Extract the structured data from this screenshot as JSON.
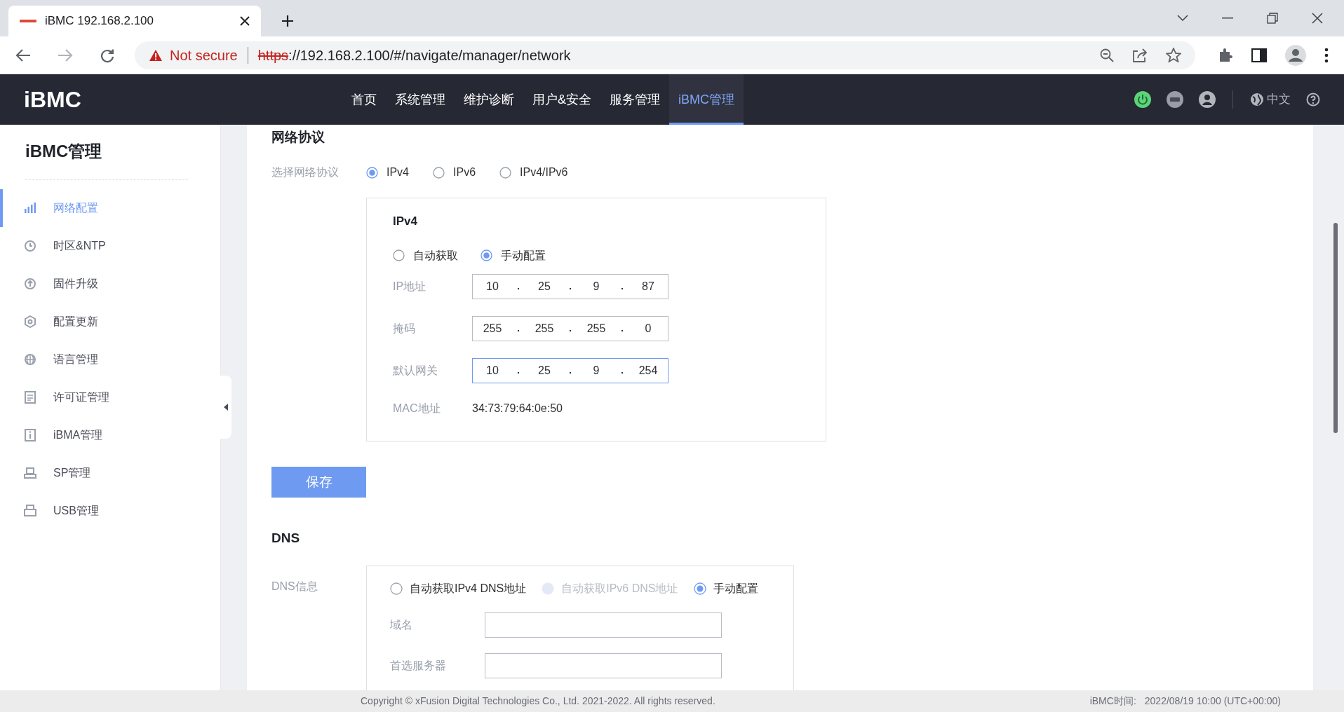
{
  "browser": {
    "tab_title": "iBMC 192.168.2.100",
    "security": "Not secure",
    "url_scheme": "https",
    "url_rest": "://192.168.2.100/#/navigate/manager/network"
  },
  "header": {
    "logo": "iBMC",
    "nav": [
      {
        "label": "首页",
        "selected": false
      },
      {
        "label": "系统管理",
        "selected": false
      },
      {
        "label": "维护诊断",
        "selected": false
      },
      {
        "label": "用户&安全",
        "selected": false
      },
      {
        "label": "服务管理",
        "selected": false
      },
      {
        "label": "iBMC管理",
        "selected": true
      }
    ],
    "language": "中文"
  },
  "sidebar": {
    "title": "iBMC管理",
    "items": [
      {
        "label": "网络配置",
        "selected": true
      },
      {
        "label": "时区&NTP",
        "selected": false
      },
      {
        "label": "固件升级",
        "selected": false
      },
      {
        "label": "配置更新",
        "selected": false
      },
      {
        "label": "语言管理",
        "selected": false
      },
      {
        "label": "许可证管理",
        "selected": false
      },
      {
        "label": "iBMA管理",
        "selected": false
      },
      {
        "label": "SP管理",
        "selected": false
      },
      {
        "label": "USB管理",
        "selected": false
      }
    ]
  },
  "protocol": {
    "title": "网络协议",
    "label": "选择网络协议",
    "options": [
      {
        "label": "IPv4",
        "selected": true
      },
      {
        "label": "IPv6",
        "selected": false
      },
      {
        "label": "IPv4/IPv6",
        "selected": false
      }
    ]
  },
  "ipv4": {
    "title": "IPv4",
    "modes": [
      {
        "label": "自动获取",
        "selected": false
      },
      {
        "label": "手动配置",
        "selected": true
      }
    ],
    "fields": [
      {
        "label": "IP地址",
        "octets": [
          "10",
          "25",
          "9",
          "87"
        ],
        "focused": false
      },
      {
        "label": "掩码",
        "octets": [
          "255",
          "255",
          "255",
          "0"
        ],
        "focused": false
      },
      {
        "label": "默认网关",
        "octets": [
          "10",
          "25",
          "9",
          "254"
        ],
        "focused": true
      }
    ],
    "mac": {
      "label": "MAC地址",
      "value": "34:73:79:64:0e:50"
    }
  },
  "save_button": "保存",
  "dns": {
    "title": "DNS",
    "label": "DNS信息",
    "options": [
      {
        "label": "自动获取IPv4 DNS地址",
        "selected": false,
        "disabled": false
      },
      {
        "label": "自动获取IPv6 DNS地址",
        "selected": false,
        "disabled": true
      },
      {
        "label": "手动配置",
        "selected": true,
        "disabled": false
      }
    ],
    "fields": [
      {
        "label": "域名"
      },
      {
        "label": "首选服务器"
      }
    ]
  },
  "footer": {
    "copyright": "Copyright © xFusion Digital Technologies Co., Ltd. 2021-2022. All rights reserved.",
    "time_label": "iBMC时间:",
    "time": "2022/08/19 10:00 (UTC+00:00)"
  }
}
